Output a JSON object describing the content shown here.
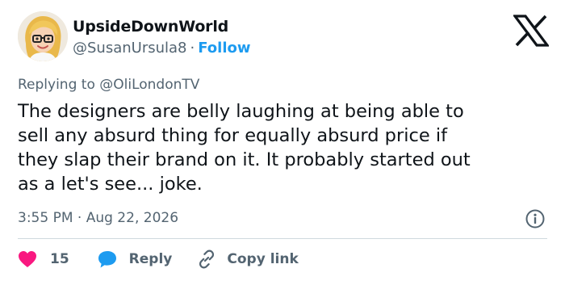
{
  "author": {
    "display_name": "UpsideDownWorld",
    "handle": "@SusanUrsula8",
    "separator": "·",
    "follow_label": "Follow"
  },
  "reply_context": {
    "prefix": "Replying to",
    "mention": "@OliLondonTV"
  },
  "tweet": {
    "lines": [
      "The designers are belly laughing at being able to",
      "sell any absurd thing for equally absurd price if",
      "they slap their brand on it.  It probably started out",
      "as a let's see...  joke."
    ],
    "timestamp": "3:55 PM · Aug 22, 2026"
  },
  "actions": {
    "like_count": "15",
    "reply_label": "Reply",
    "copy_link_label": "Copy link"
  },
  "icons": {
    "logo": "x-logo-icon",
    "info": "info-icon",
    "like": "heart-icon",
    "reply": "speech-bubble-icon",
    "copy": "link-icon"
  },
  "colors": {
    "accent": "#1d9bf0",
    "like": "#f91880",
    "secondary_text": "#536471",
    "primary_text": "#0f1419",
    "divider": "#cfd9de"
  }
}
